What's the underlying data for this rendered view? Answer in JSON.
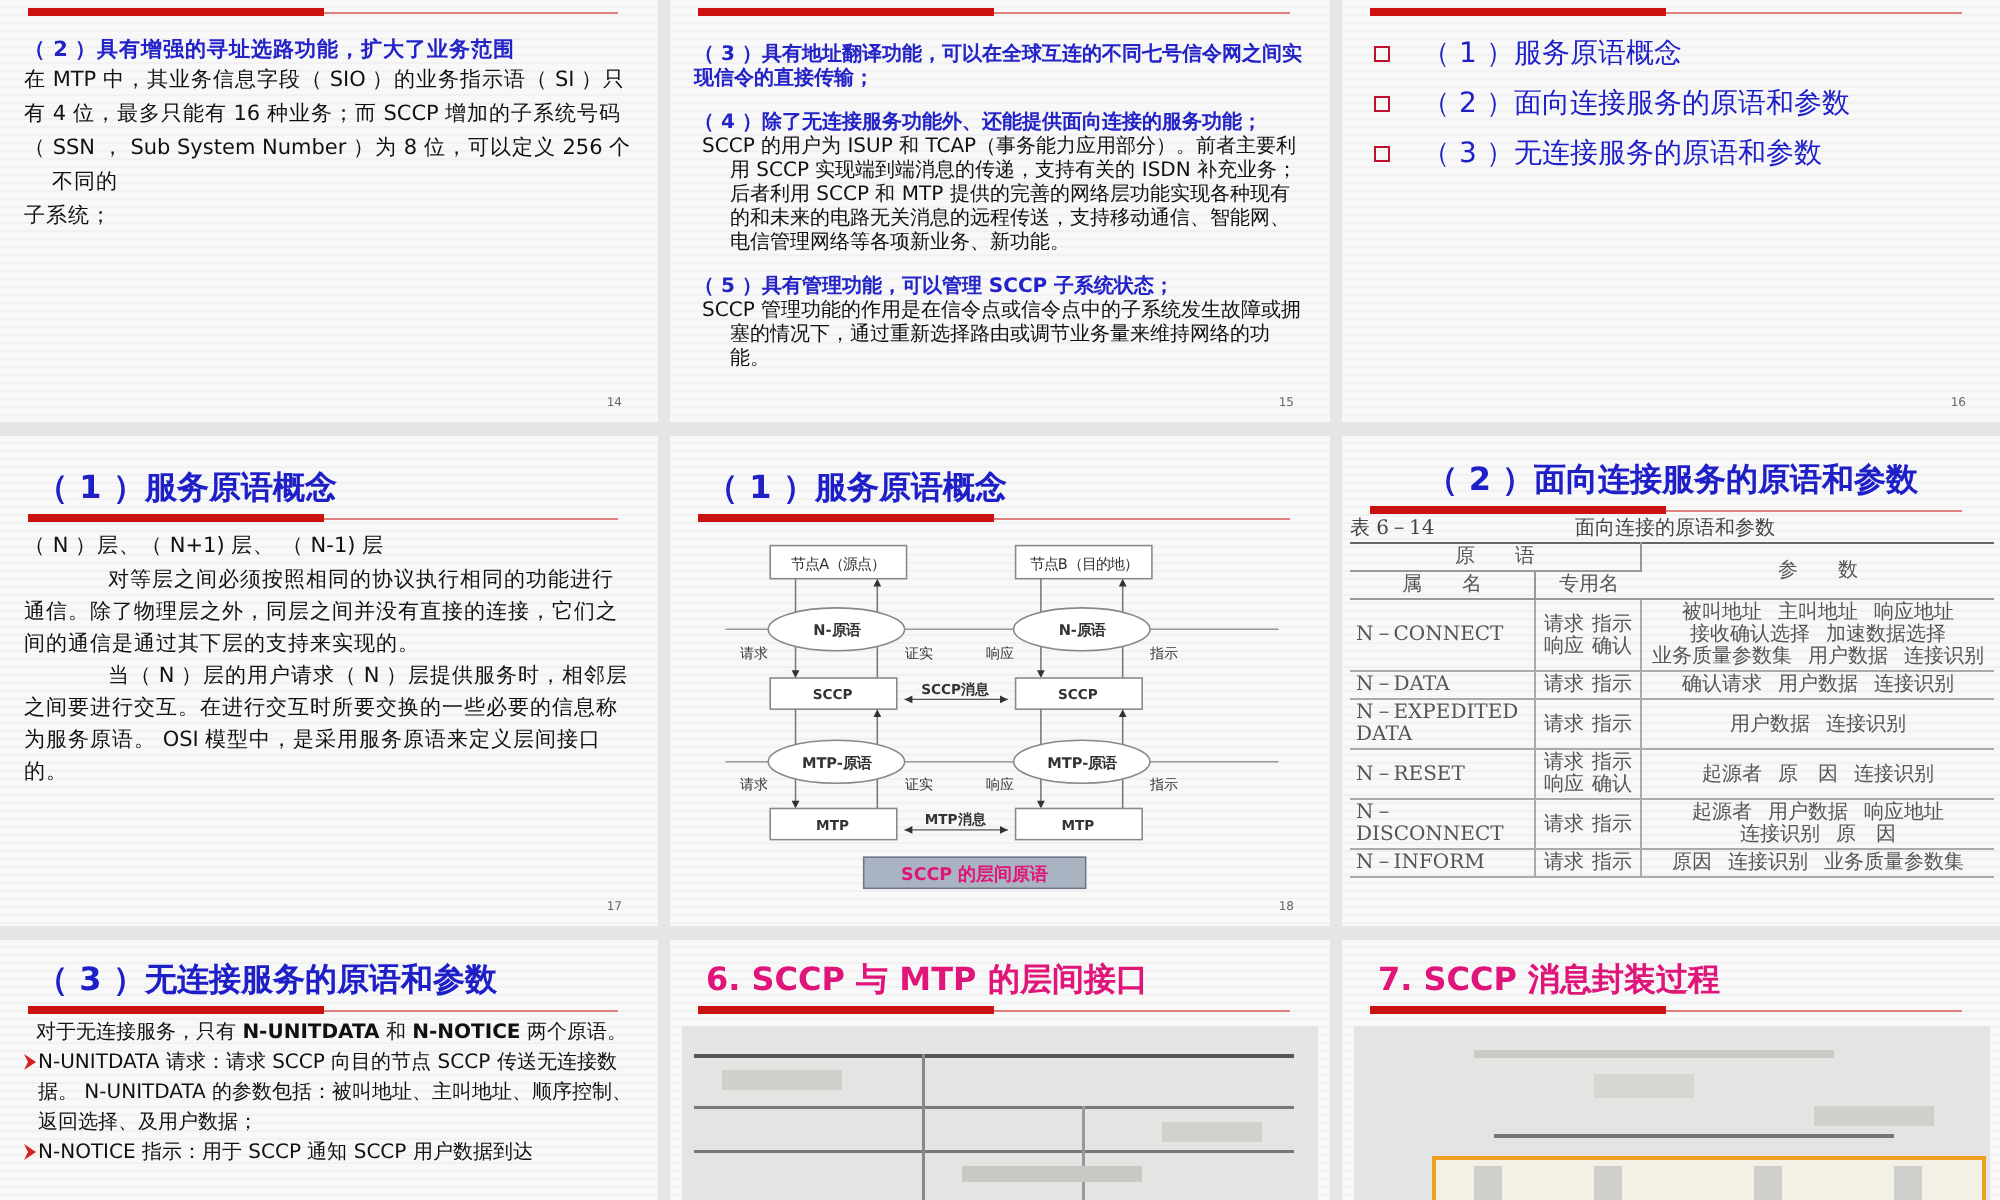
{
  "slides": [
    {
      "kind": "text",
      "number": "14",
      "blocks": [
        {
          "kind": "lead",
          "text": "（ 2 ）具有增强的寻址选路功能，扩大了业务范围"
        },
        {
          "kind": "body",
          "text": "在 MTP 中，其业务信息字段（ SIO ）的业务指示语（ SI ）只"
        },
        {
          "kind": "body",
          "text": "有 4 位，最多只能有 16  种业务；而 SCCP 增加的子系统号码"
        },
        {
          "kind": "body",
          "text": "（ SSN ， Sub System Number ）为 8 位，可以定义 256 个不同的"
        },
        {
          "kind": "body",
          "text": "子系统；"
        }
      ]
    },
    {
      "kind": "text",
      "number": "15",
      "blocks": [
        {
          "kind": "lead",
          "text": "（ 3 ）具有地址翻译功能，可以在全球互连的不同七号信令网之间实现信令的直接传输；"
        },
        {
          "kind": "lead",
          "text": "（ 4 ）除了无连接服务功能外、还能提供面向连接的服务功能；"
        },
        {
          "kind": "body",
          "text": "SCCP 的用户为 ISUP 和 TCAP（事务能力应用部分）。前者主要利用 SCCP 实现端到端消息的传递，支持有关的 ISDN 补充业务；后者利用 SCCP 和 MTP 提供的完善的网络层功能实现各种现有的和未来的电路无关消息的远程传送，支持移动通信、智能网、电信管理网络等各项新业务、新功能。"
        },
        {
          "kind": "lead",
          "text": "（ 5 ）具有管理功能，可以管理 SCCP 子系统状态；"
        },
        {
          "kind": "body",
          "text": "SCCP 管理功能的作用是在信令点或信令点中的子系统发生故障或拥塞的情况下，通过重新选择路由或调节业务量来维持网络的功能。"
        }
      ]
    },
    {
      "kind": "bullets",
      "number": "16",
      "items": [
        "（ 1 ）服务原语概念",
        "（ 2 ）面向连接服务的原语和参数",
        "（ 3 ）无连接服务的原语和参数"
      ]
    },
    {
      "kind": "text",
      "number": "17",
      "title": {
        "text": "（ 1 ）服务原语概念",
        "color": "#1f1fc8"
      },
      "blocks": [
        {
          "kind": "body",
          "text": "（ N ）层、（ N+1) 层、 （ N-1) 层"
        },
        {
          "kind": "para",
          "text": "对等层之间必须按照相同的协议执行相同的功能进行通信。除了物理层之外，同层之间并没有直接的连接，它们之间的通信是通过其下层的支持来实现的。"
        },
        {
          "kind": "para",
          "text": "当（ N ）层的用户请求（ N ）层提供服务时，相邻层之间要进行交互。在进行交互时所要交换的一些必要的信息称为服务原语。 OSI 模型中，是采用服务原语来定义层间接口的。"
        }
      ]
    },
    {
      "kind": "diagram",
      "number": "18",
      "title": {
        "text": "（ 1 ）服务原语概念",
        "color": "#1f1fc8"
      },
      "diagram": {
        "nodes": [
          "节点A（源点）",
          "节点B（目的地）"
        ],
        "levels": [
          {
            "left": {
              "primitive": "N-原语",
              "layer": "SCCP"
            },
            "right": {
              "primitive": "N-原语",
              "layer": "SCCP"
            },
            "message": "SCCP消息",
            "labels": [
              "请求",
              "证实",
              "响应",
              "指示"
            ]
          },
          {
            "left": {
              "primitive": "MTP-原语",
              "layer": "MTP"
            },
            "right": {
              "primitive": "MTP-原语",
              "layer": "MTP"
            },
            "message": "MTP消息",
            "labels": [
              "请求",
              "证实",
              "响应",
              "指示"
            ]
          }
        ],
        "caption": "SCCP 的层间原语"
      }
    },
    {
      "kind": "table",
      "title": {
        "text": "（ 2 ）面向连接服务的原语和参数",
        "color": "#1f1fc8"
      },
      "table": {
        "label": "表 6－14",
        "caption": "面向连接的原语和参数",
        "group_header": "原　　语",
        "params_header": "参　　数",
        "name_header": "属　　名",
        "usage_header": "专用名",
        "rows": [
          {
            "name": [
              "N－CONNECT"
            ],
            "usage": [
              "请求",
              "指示",
              "响应",
              "确认"
            ],
            "params": [
              "被叫地址",
              "主叫地址",
              "响应地址",
              "接收确认选择",
              "加速数据选择",
              "业务质量参数集",
              "用户数据",
              "连接识别"
            ]
          },
          {
            "name": [
              "N－DATA"
            ],
            "usage": [
              "请求",
              "指示"
            ],
            "params": [
              "确认请求",
              "用户数据",
              "连接识别"
            ]
          },
          {
            "name": [
              "N－EXPEDITED",
              "DATA"
            ],
            "usage": [
              "请求",
              "指示"
            ],
            "params": [
              "用户数据",
              "连接识别"
            ]
          },
          {
            "name": [
              "N－RESET"
            ],
            "usage": [
              "请求",
              "指示",
              "响应",
              "确认"
            ],
            "params": [
              "起源者",
              "原　因",
              "连接识别"
            ]
          },
          {
            "name": [
              "N－DISCONNECT"
            ],
            "usage": [
              "请求",
              "指示"
            ],
            "params": [
              "起源者",
              "用户数据",
              "响应地址",
              "连接识别",
              "原　因"
            ]
          },
          {
            "name": [
              "N－INFORM"
            ],
            "usage": [
              "请求",
              "指示"
            ],
            "params": [
              "原因",
              "连接识别",
              "业务质量参数集"
            ]
          }
        ]
      }
    },
    {
      "kind": "text",
      "title": {
        "text": "（ 3 ）无连接服务的原语和参数",
        "color": "#1f1fc8"
      },
      "blocks": [
        {
          "kind": "intro",
          "text": "对于无连接服务，只有 **N-UNITDATA** 和 **N-NOTICE** 两个原语。"
        },
        {
          "kind": "bullet",
          "text": "N-UNITDATA 请求：请求 SCCP 向目的节点 SCCP 传送无连接数据。 N-UNITDATA  的参数包括：被叫地址、主叫地址、顺序控制、返回选择、及用户数据；"
        },
        {
          "kind": "bullet",
          "text": "N-NOTICE 指示：用于 SCCP 通知 SCCP 用户数据到达"
        }
      ]
    },
    {
      "kind": "scan",
      "title": {
        "text": "6.  SCCP 与 MTP 的层间接口",
        "color": "#e0157a"
      }
    },
    {
      "kind": "scan",
      "title": {
        "text": "7.  SCCP 消息封装过程",
        "color": "#e0157a"
      }
    }
  ]
}
